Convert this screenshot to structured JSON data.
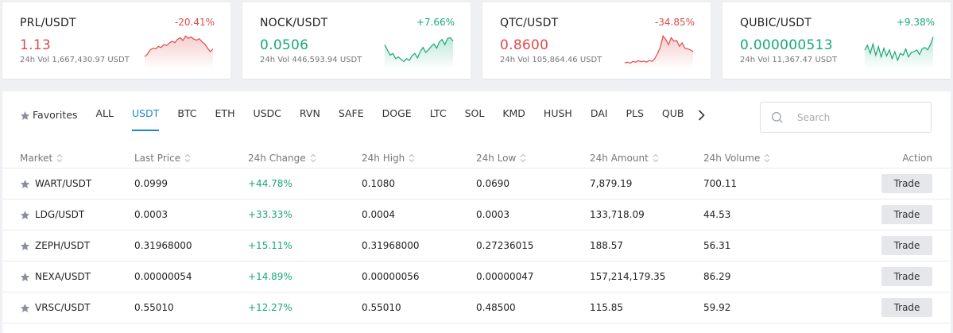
{
  "colors": {
    "negative": "#e04a4a",
    "positive": "#1aa876",
    "accent": "#1e88c9"
  },
  "tickers": [
    {
      "pair": "PRL/USDT",
      "change": "-20.41%",
      "price": "1.13",
      "volume": "24h Vol 1,667,430.97 USDT",
      "trend": "down",
      "spark": [
        0.36,
        0.42,
        0.55,
        0.6,
        0.58,
        0.65,
        0.62,
        0.7,
        0.68,
        0.74,
        0.8,
        0.76,
        0.85,
        0.9,
        0.82,
        0.95,
        0.88,
        0.92,
        0.86,
        0.83,
        0.87,
        0.78,
        0.72,
        0.6,
        0.5,
        0.58
      ]
    },
    {
      "pair": "NOCK/USDT",
      "change": "+7.66%",
      "price": "0.0506",
      "volume": "24h Vol 446,593.94 USDT",
      "trend": "up",
      "spark": [
        0.7,
        0.55,
        0.4,
        0.45,
        0.3,
        0.35,
        0.28,
        0.22,
        0.3,
        0.25,
        0.38,
        0.45,
        0.32,
        0.5,
        0.62,
        0.48,
        0.55,
        0.65,
        0.72,
        0.6,
        0.78,
        0.85,
        0.7,
        0.88,
        0.9,
        0.8
      ]
    },
    {
      "pair": "QTC/USDT",
      "change": "-34.85%",
      "price": "0.8600",
      "volume": "24h Vol 105,864.46 USDT",
      "trend": "down",
      "spark": [
        0.18,
        0.2,
        0.17,
        0.22,
        0.2,
        0.24,
        0.21,
        0.23,
        0.2,
        0.25,
        0.22,
        0.3,
        0.45,
        0.62,
        0.95,
        0.85,
        0.7,
        0.9,
        0.8,
        0.82,
        0.65,
        0.75,
        0.6,
        0.58,
        0.55,
        0.5
      ]
    },
    {
      "pair": "QUBIC/USDT",
      "change": "+9.38%",
      "price": "0.000000513",
      "volume": "24h Vol 11,367.47 USDT",
      "trend": "up",
      "spark": [
        0.55,
        0.68,
        0.45,
        0.72,
        0.4,
        0.65,
        0.35,
        0.6,
        0.38,
        0.55,
        0.3,
        0.5,
        0.25,
        0.45,
        0.4,
        0.58,
        0.35,
        0.48,
        0.5,
        0.55,
        0.42,
        0.58,
        0.62,
        0.55,
        0.7,
        0.92
      ]
    }
  ],
  "tabs": {
    "favorites": "Favorites",
    "items": [
      "ALL",
      "USDT",
      "BTC",
      "ETH",
      "USDC",
      "RVN",
      "SAFE",
      "DOGE",
      "LTC",
      "SOL",
      "KMD",
      "HUSH",
      "DAI",
      "PLS",
      "QUB"
    ],
    "active_index": 1
  },
  "search": {
    "placeholder": "Search"
  },
  "table": {
    "headers": {
      "market": "Market",
      "last": "Last Price",
      "change": "24h Change",
      "high": "24h High",
      "low": "24h Low",
      "amount": "24h Amount",
      "volume": "24h Volume",
      "action": "Action"
    },
    "rows": [
      {
        "market": "WART/USDT",
        "last": "0.0999",
        "change": "+44.78%",
        "high": "0.1080",
        "low": "0.0690",
        "amount": "7,879.19",
        "volume": "700.11",
        "action": "Trade"
      },
      {
        "market": "LDG/USDT",
        "last": "0.0003",
        "change": "+33.33%",
        "high": "0.0004",
        "low": "0.0003",
        "amount": "133,718.09",
        "volume": "44.53",
        "action": "Trade"
      },
      {
        "market": "ZEPH/USDT",
        "last": "0.31968000",
        "change": "+15.11%",
        "high": "0.31968000",
        "low": "0.27236015",
        "amount": "188.57",
        "volume": "56.31",
        "action": "Trade"
      },
      {
        "market": "NEXA/USDT",
        "last": "0.00000054",
        "change": "+14.89%",
        "high": "0.00000056",
        "low": "0.00000047",
        "amount": "157,214,179.35",
        "volume": "86.29",
        "action": "Trade"
      },
      {
        "market": "VRSC/USDT",
        "last": "0.55010",
        "change": "+12.27%",
        "high": "0.55010",
        "low": "0.48500",
        "amount": "115.85",
        "volume": "59.92",
        "action": "Trade"
      }
    ]
  }
}
